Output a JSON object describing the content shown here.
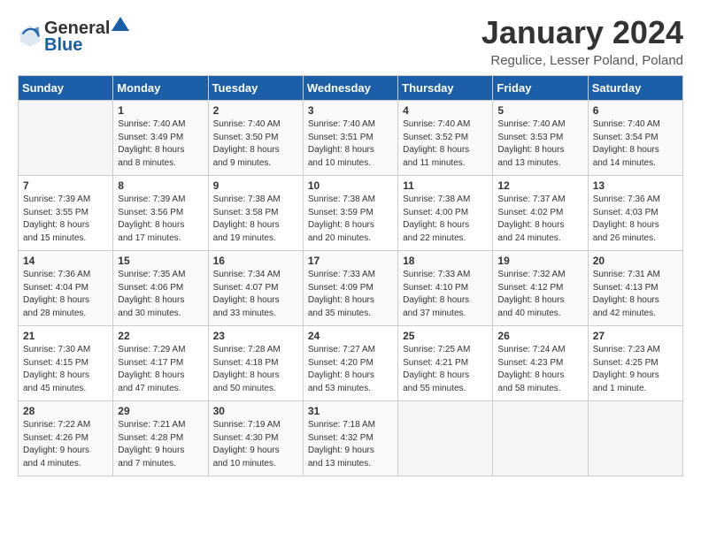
{
  "header": {
    "logo_line1": "General",
    "logo_line2": "Blue",
    "month_title": "January 2024",
    "location": "Regulice, Lesser Poland, Poland"
  },
  "days_of_week": [
    "Sunday",
    "Monday",
    "Tuesday",
    "Wednesday",
    "Thursday",
    "Friday",
    "Saturday"
  ],
  "weeks": [
    [
      {
        "day": "",
        "info": ""
      },
      {
        "day": "1",
        "info": "Sunrise: 7:40 AM\nSunset: 3:49 PM\nDaylight: 8 hours\nand 8 minutes."
      },
      {
        "day": "2",
        "info": "Sunrise: 7:40 AM\nSunset: 3:50 PM\nDaylight: 8 hours\nand 9 minutes."
      },
      {
        "day": "3",
        "info": "Sunrise: 7:40 AM\nSunset: 3:51 PM\nDaylight: 8 hours\nand 10 minutes."
      },
      {
        "day": "4",
        "info": "Sunrise: 7:40 AM\nSunset: 3:52 PM\nDaylight: 8 hours\nand 11 minutes."
      },
      {
        "day": "5",
        "info": "Sunrise: 7:40 AM\nSunset: 3:53 PM\nDaylight: 8 hours\nand 13 minutes."
      },
      {
        "day": "6",
        "info": "Sunrise: 7:40 AM\nSunset: 3:54 PM\nDaylight: 8 hours\nand 14 minutes."
      }
    ],
    [
      {
        "day": "7",
        "info": "Sunrise: 7:39 AM\nSunset: 3:55 PM\nDaylight: 8 hours\nand 15 minutes."
      },
      {
        "day": "8",
        "info": "Sunrise: 7:39 AM\nSunset: 3:56 PM\nDaylight: 8 hours\nand 17 minutes."
      },
      {
        "day": "9",
        "info": "Sunrise: 7:38 AM\nSunset: 3:58 PM\nDaylight: 8 hours\nand 19 minutes."
      },
      {
        "day": "10",
        "info": "Sunrise: 7:38 AM\nSunset: 3:59 PM\nDaylight: 8 hours\nand 20 minutes."
      },
      {
        "day": "11",
        "info": "Sunrise: 7:38 AM\nSunset: 4:00 PM\nDaylight: 8 hours\nand 22 minutes."
      },
      {
        "day": "12",
        "info": "Sunrise: 7:37 AM\nSunset: 4:02 PM\nDaylight: 8 hours\nand 24 minutes."
      },
      {
        "day": "13",
        "info": "Sunrise: 7:36 AM\nSunset: 4:03 PM\nDaylight: 8 hours\nand 26 minutes."
      }
    ],
    [
      {
        "day": "14",
        "info": "Sunrise: 7:36 AM\nSunset: 4:04 PM\nDaylight: 8 hours\nand 28 minutes."
      },
      {
        "day": "15",
        "info": "Sunrise: 7:35 AM\nSunset: 4:06 PM\nDaylight: 8 hours\nand 30 minutes."
      },
      {
        "day": "16",
        "info": "Sunrise: 7:34 AM\nSunset: 4:07 PM\nDaylight: 8 hours\nand 33 minutes."
      },
      {
        "day": "17",
        "info": "Sunrise: 7:33 AM\nSunset: 4:09 PM\nDaylight: 8 hours\nand 35 minutes."
      },
      {
        "day": "18",
        "info": "Sunrise: 7:33 AM\nSunset: 4:10 PM\nDaylight: 8 hours\nand 37 minutes."
      },
      {
        "day": "19",
        "info": "Sunrise: 7:32 AM\nSunset: 4:12 PM\nDaylight: 8 hours\nand 40 minutes."
      },
      {
        "day": "20",
        "info": "Sunrise: 7:31 AM\nSunset: 4:13 PM\nDaylight: 8 hours\nand 42 minutes."
      }
    ],
    [
      {
        "day": "21",
        "info": "Sunrise: 7:30 AM\nSunset: 4:15 PM\nDaylight: 8 hours\nand 45 minutes."
      },
      {
        "day": "22",
        "info": "Sunrise: 7:29 AM\nSunset: 4:17 PM\nDaylight: 8 hours\nand 47 minutes."
      },
      {
        "day": "23",
        "info": "Sunrise: 7:28 AM\nSunset: 4:18 PM\nDaylight: 8 hours\nand 50 minutes."
      },
      {
        "day": "24",
        "info": "Sunrise: 7:27 AM\nSunset: 4:20 PM\nDaylight: 8 hours\nand 53 minutes."
      },
      {
        "day": "25",
        "info": "Sunrise: 7:25 AM\nSunset: 4:21 PM\nDaylight: 8 hours\nand 55 minutes."
      },
      {
        "day": "26",
        "info": "Sunrise: 7:24 AM\nSunset: 4:23 PM\nDaylight: 8 hours\nand 58 minutes."
      },
      {
        "day": "27",
        "info": "Sunrise: 7:23 AM\nSunset: 4:25 PM\nDaylight: 9 hours\nand 1 minute."
      }
    ],
    [
      {
        "day": "28",
        "info": "Sunrise: 7:22 AM\nSunset: 4:26 PM\nDaylight: 9 hours\nand 4 minutes."
      },
      {
        "day": "29",
        "info": "Sunrise: 7:21 AM\nSunset: 4:28 PM\nDaylight: 9 hours\nand 7 minutes."
      },
      {
        "day": "30",
        "info": "Sunrise: 7:19 AM\nSunset: 4:30 PM\nDaylight: 9 hours\nand 10 minutes."
      },
      {
        "day": "31",
        "info": "Sunrise: 7:18 AM\nSunset: 4:32 PM\nDaylight: 9 hours\nand 13 minutes."
      },
      {
        "day": "",
        "info": ""
      },
      {
        "day": "",
        "info": ""
      },
      {
        "day": "",
        "info": ""
      }
    ]
  ]
}
